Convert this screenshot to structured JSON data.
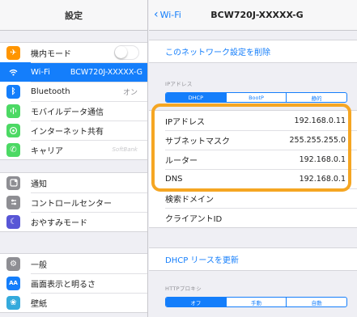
{
  "sidebar": {
    "title": "設定",
    "groups": [
      [
        {
          "label": "機内モード",
          "icon": "airplane-icon",
          "color": "#ff9500",
          "toggle": true
        },
        {
          "label": "Wi-Fi",
          "icon": "wifi-icon",
          "color": "#147efb",
          "value": "BCW720J-XXXXX-G",
          "selected": true
        },
        {
          "label": "Bluetooth",
          "icon": "bluetooth-icon",
          "color": "#147efb",
          "value": "オン"
        },
        {
          "label": "モバイルデータ通信",
          "icon": "cellular-icon",
          "color": "#4cd964"
        },
        {
          "label": "インターネット共有",
          "icon": "hotspot-icon",
          "color": "#4cd964"
        },
        {
          "label": "キャリア",
          "icon": "phone-icon",
          "color": "#4cd964",
          "value": "SoftBank"
        }
      ],
      [
        {
          "label": "通知",
          "icon": "notifications-icon",
          "color": "#8e8e93"
        },
        {
          "label": "コントロールセンター",
          "icon": "control-center-icon",
          "color": "#8e8e93"
        },
        {
          "label": "おやすみモード",
          "icon": "moon-icon",
          "color": "#5856d6"
        }
      ],
      [
        {
          "label": "一般",
          "icon": "gear-icon",
          "color": "#8e8e93"
        },
        {
          "label": "画面表示と明るさ",
          "icon": "brightness-icon",
          "color": "#147efb"
        },
        {
          "label": "壁紙",
          "icon": "wallpaper-icon",
          "color": "#34aadc"
        }
      ]
    ]
  },
  "detail": {
    "back_label": "Wi-Fi",
    "title": "BCW720J-XXXXX-G",
    "forget_label": "このネットワーク設定を削除",
    "ip_section_label": "IPアドレス",
    "ip_tabs": [
      {
        "label": "DHCP",
        "selected": true
      },
      {
        "label": "BootP",
        "selected": false
      },
      {
        "label": "静的",
        "selected": false
      }
    ],
    "ip_rows": [
      {
        "label": "IPアドレス",
        "value": "192.168.0.11"
      },
      {
        "label": "サブネットマスク",
        "value": "255.255.255.0"
      },
      {
        "label": "ルーター",
        "value": "192.168.0.1"
      },
      {
        "label": "DNS",
        "value": "192.168.0.1"
      },
      {
        "label": "検索ドメイン",
        "value": ""
      },
      {
        "label": "クライアントID",
        "value": ""
      }
    ],
    "renew_label": "DHCP リースを更新",
    "proxy_section_label": "HTTPプロキシ",
    "proxy_tabs": [
      {
        "label": "オフ",
        "selected": true
      },
      {
        "label": "手動",
        "selected": false
      },
      {
        "label": "自動",
        "selected": false
      }
    ]
  },
  "colors": {
    "accent": "#147efb",
    "highlight": "#f5a623"
  }
}
